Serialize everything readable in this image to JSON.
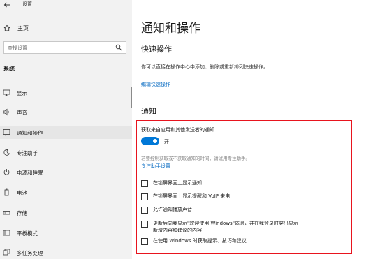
{
  "window": {
    "title": "设置"
  },
  "sidebar": {
    "home_label": "主页",
    "search_placeholder": "查找设置",
    "section_heading": "系统",
    "items": [
      {
        "label": "显示",
        "icon": "monitor-icon"
      },
      {
        "label": "声音",
        "icon": "speaker-icon"
      },
      {
        "label": "通知和操作",
        "icon": "notification-icon",
        "active": true
      },
      {
        "label": "专注助手",
        "icon": "moon-icon"
      },
      {
        "label": "电源和睡眠",
        "icon": "power-icon"
      },
      {
        "label": "电池",
        "icon": "battery-icon"
      },
      {
        "label": "存储",
        "icon": "storage-icon"
      },
      {
        "label": "平板模式",
        "icon": "tablet-icon"
      },
      {
        "label": "多任务处理",
        "icon": "multitask-icon"
      }
    ]
  },
  "main": {
    "page_title": "通知和操作",
    "quick_actions_heading": "快速操作",
    "quick_actions_desc": "你可以直接在操作中心中添加、删除或重新排列快速操作。",
    "edit_quick_actions_link": "编辑快速操作",
    "notifications_heading": "通知",
    "get_notifications_label": "获取来自应用和其他发送者的通知",
    "toggle_state_label": "开",
    "toggle_on": true,
    "hint_text": "若要控制获取或不获取通知的时间，请试用专注助手。",
    "focus_assist_link": "专注助手设置",
    "options": [
      {
        "label": "在锁屏界面上显示通知",
        "checked": false
      },
      {
        "label": "在锁屏界面上显示提醒和 VoIP 来电",
        "checked": false
      },
      {
        "label": "允许通知播放声音",
        "checked": false
      },
      {
        "label": "更新后向我显示\"欢迎使用 Windows\"体验，并在我登录时突出显示",
        "label_line2": "新增内容和建议的内容",
        "checked": false
      },
      {
        "label": "在使用 Windows 时获取提示、技巧和建议",
        "checked": false
      }
    ],
    "accent_color": "#0078d7",
    "highlight_color": "#e8141e"
  }
}
